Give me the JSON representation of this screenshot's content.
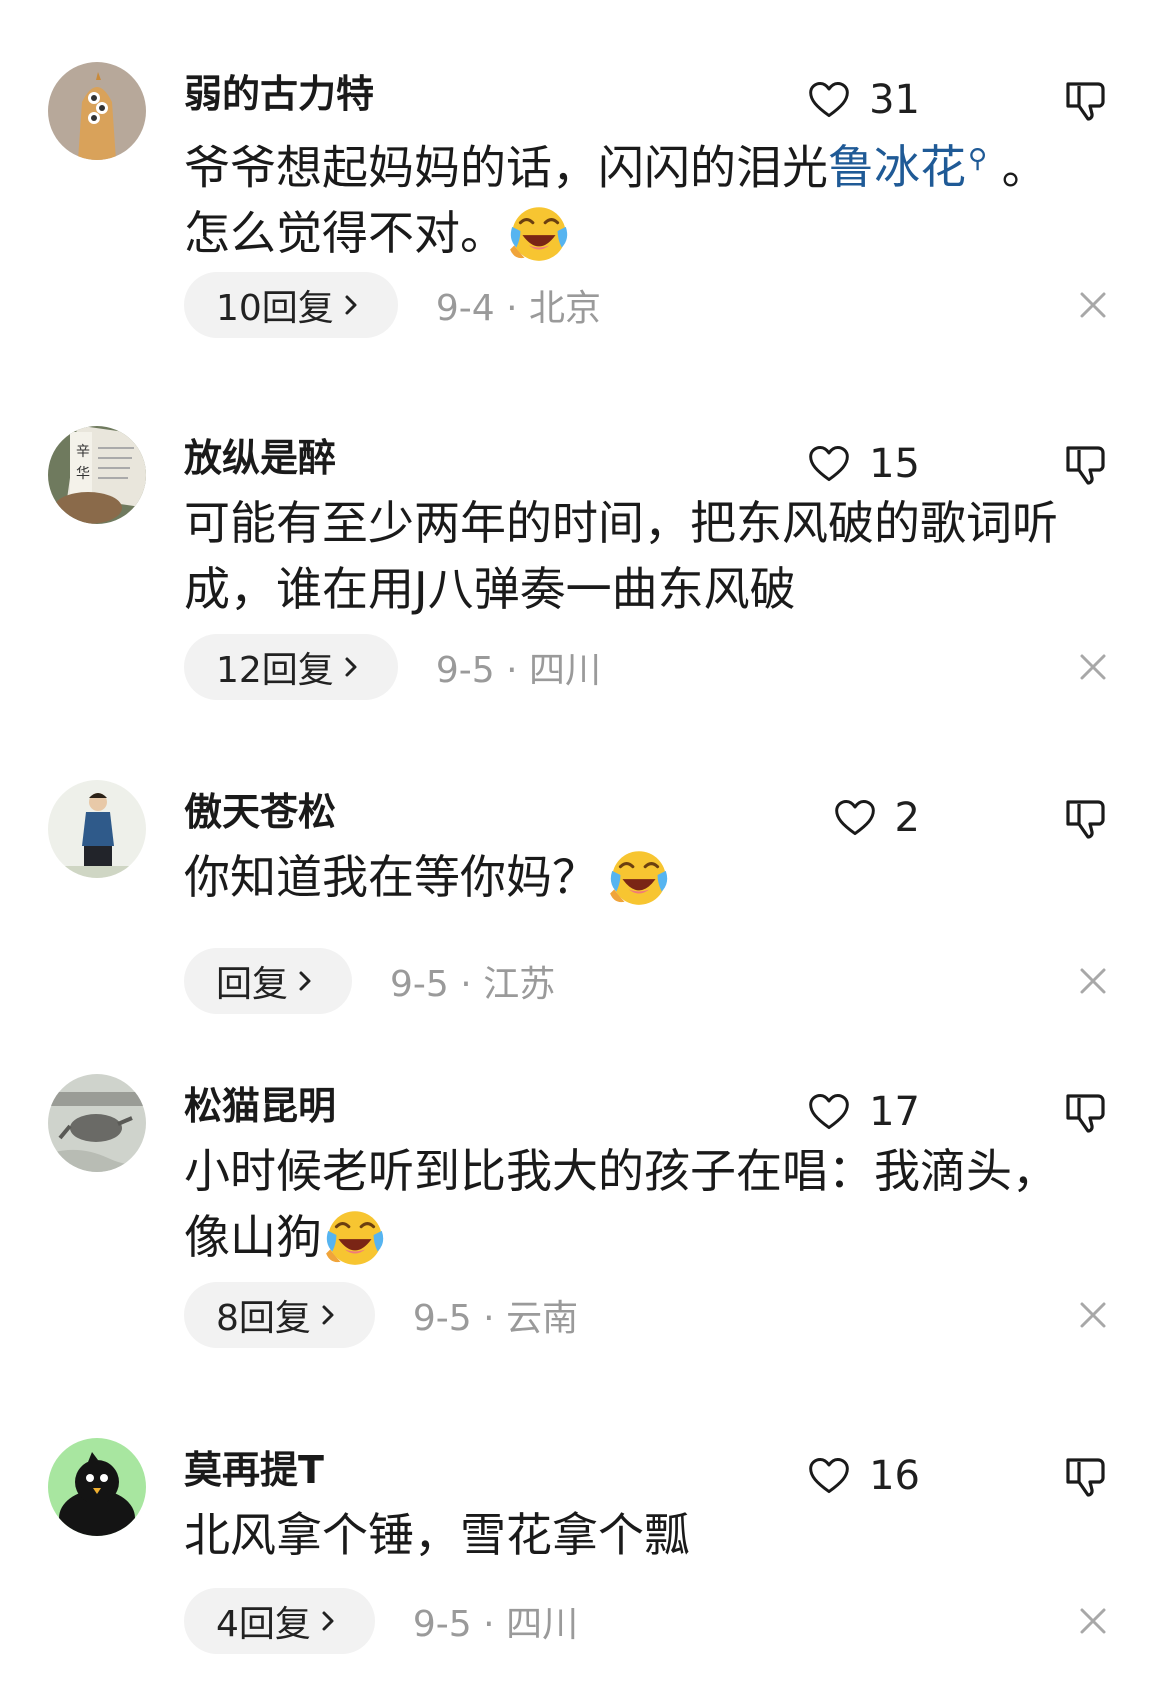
{
  "comments": [
    {
      "username": "弱的古力特",
      "likes": "31",
      "text_parts": [
        "爷爷想起妈妈的话，闪闪的泪光",
        "鲁冰花",
        " 。",
        "怎么觉得不对。"
      ],
      "reply_label": "10回复",
      "date": "9-4",
      "location": "北京"
    },
    {
      "username": "放纵是醉",
      "likes": "15",
      "text_line1": "可能有至少两年的时间，把东风破的歌词听",
      "text_line2": "成，谁在用J八弹奏一曲东风破",
      "reply_label": "12回复",
      "date": "9-5",
      "location": "四川"
    },
    {
      "username": "傲天苍松",
      "likes": "2",
      "text_line1": "你知道我在等你妈？",
      "reply_label": "回复",
      "date": "9-5",
      "location": "江苏"
    },
    {
      "username": "松猫昆明",
      "likes": "17",
      "text_line1": "小时候老听到比我大的孩子在唱：我滴头，",
      "text_line2": "像山狗",
      "reply_label": "8回复",
      "date": "9-5",
      "location": "云南"
    },
    {
      "username": "莫再提T",
      "likes": "16",
      "text_line1": "北风拿个锤，雪花拿个瓢",
      "reply_label": "4回复",
      "date": "9-5",
      "location": "四川"
    }
  ],
  "meta_separator": "·",
  "icons": {
    "like": "heart-outline-icon",
    "dislike": "thumbs-down-outline-icon",
    "emoji": "laughing-crying-emoji",
    "search_link": "search-icon",
    "close": "close-icon",
    "chevron": "chevron-right-icon"
  },
  "colors": {
    "link": "#1f5a96",
    "meta": "#9a9a9a",
    "pill_bg": "#f2f2f2"
  }
}
